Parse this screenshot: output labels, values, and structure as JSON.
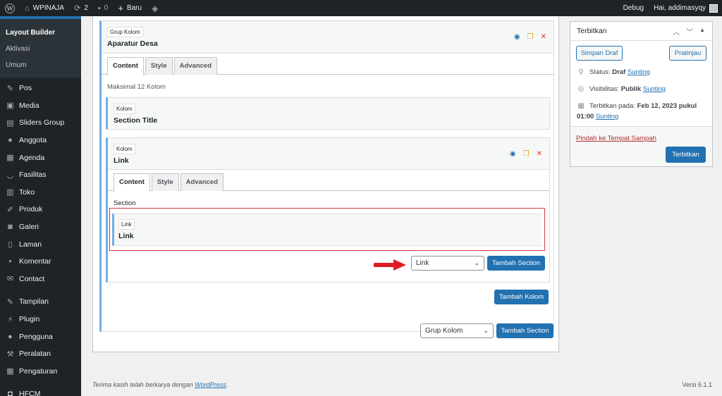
{
  "adminbar": {
    "site_name": "WPINAJA",
    "updates_count": "2",
    "comments_count": "0",
    "new_label": "Baru",
    "debug_label": "Debug",
    "greeting": "Hai, addimasyqy"
  },
  "sidebar": {
    "submenu": [
      "Layout Builder",
      "Aktivasi",
      "Umum"
    ],
    "items": [
      {
        "label": "Pos",
        "icon": "pin-icon"
      },
      {
        "label": "Media",
        "icon": "media-icon"
      },
      {
        "label": "Sliders Group",
        "icon": "sliders-icon"
      },
      {
        "label": "Anggota",
        "icon": "user-icon"
      },
      {
        "label": "Agenda",
        "icon": "calendar-icon"
      },
      {
        "label": "Fasilitas",
        "icon": "smile-icon"
      },
      {
        "label": "Toko",
        "icon": "store-icon"
      },
      {
        "label": "Produk",
        "icon": "brush-icon"
      },
      {
        "label": "Galeri",
        "icon": "camera-icon"
      },
      {
        "label": "Laman",
        "icon": "page-icon"
      },
      {
        "label": "Komentar",
        "icon": "comment-icon"
      },
      {
        "label": "Contact",
        "icon": "mail-icon"
      },
      {
        "label": "Tampilan",
        "icon": "paintbrush-icon"
      },
      {
        "label": "Plugin",
        "icon": "plugin-icon"
      },
      {
        "label": "Pengguna",
        "icon": "users-icon"
      },
      {
        "label": "Peralatan",
        "icon": "wrench-icon"
      },
      {
        "label": "Pengaturan",
        "icon": "settings-icon"
      },
      {
        "label": "HFCM",
        "icon": "robot-icon"
      }
    ]
  },
  "builder": {
    "group_tag": "Grup Kolom",
    "group_title": "Aparatur Desa",
    "tabs": [
      "Content",
      "Style",
      "Advanced"
    ],
    "max_note": "Maksimal 12 Kolom",
    "col1_tag": "Kolom",
    "col1_title": "Section Title",
    "col2_tag": "Kolom",
    "col2_title": "Link",
    "section_label": "Section",
    "link_tag": "Link",
    "link_title": "Link",
    "section_select": "Link",
    "add_section_label": "Tambah Section",
    "add_column_label": "Tambah Kolom",
    "group_select": "Grup Kolom",
    "add_section_bottom_label": "Tambah Section"
  },
  "publish": {
    "title": "Terbitkan",
    "save_draft": "Simpan Draf",
    "preview": "Pratinjau",
    "status_label": "Status: ",
    "status_value": "Draf",
    "visibility_label": "Visibilitas: ",
    "visibility_value": "Publik",
    "published_label": "Terbitkan pada: ",
    "published_value": "Feb 12, 2023 pukul",
    "published_time": "01:00",
    "edit_link": "Sunting",
    "trash_link": "Pindah ke Tempat Sampah",
    "publish_button": "Terbitkan"
  },
  "footer": {
    "thanks": "Terima kasih telah berkarya dengan ",
    "wp_link": "WordPress",
    "period": ".",
    "version": "Versi 6.1.1"
  }
}
